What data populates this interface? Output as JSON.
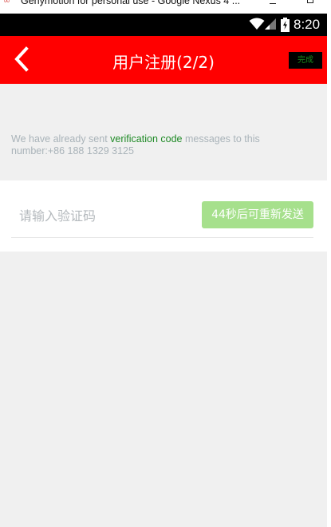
{
  "window": {
    "title": "Genymotion for personal use - Google Nexus 4 ..."
  },
  "status_bar": {
    "time": "8:20",
    "icons": [
      "wifi-icon",
      "signal-icon",
      "battery-charging-icon"
    ]
  },
  "app_bar": {
    "back_icon": "chevron-left-icon",
    "title": "用户注册(2/2)",
    "done_label": "完成"
  },
  "message": {
    "prefix": "We have already sent ",
    "highlight": "verification code",
    "suffix": " messages to this number:+86 188 1329 3125"
  },
  "code_form": {
    "placeholder": "请输入验证码",
    "value": "",
    "resend_label": "44秒后可重新发送"
  },
  "colors": {
    "app_bar": "#ff0000",
    "highlight": "#1f8a26",
    "resend_button": "#a6e08c",
    "background": "#f0f0f0"
  }
}
